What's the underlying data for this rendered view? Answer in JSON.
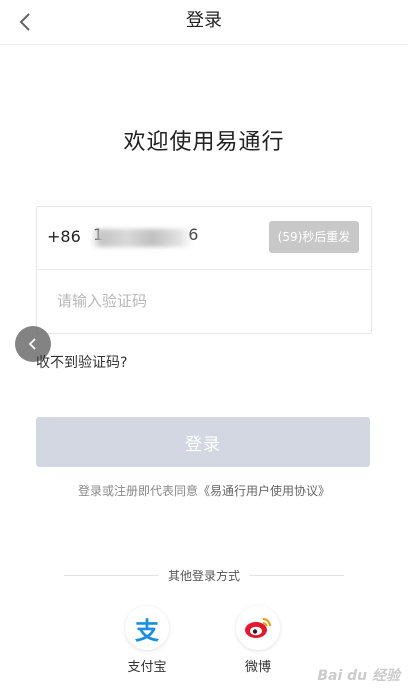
{
  "navbar": {
    "title": "登录"
  },
  "welcome": "欢迎使用易通行",
  "form": {
    "country_code": "+86",
    "phone_value": "1",
    "phone_tail": "6",
    "resend_label": "(59)秒后重发",
    "code_placeholder": "请输入验证码"
  },
  "no_code_link": "收不到验证码?",
  "login_button": "登录",
  "agreement": {
    "prefix": "登录或注册即代表同意",
    "link": "《易通行用户使用协议》"
  },
  "other_login": {
    "title": "其他登录方式",
    "methods": [
      {
        "label": "支付宝",
        "icon": "alipay-icon",
        "glyph": "支",
        "color": "#1a8fe1"
      },
      {
        "label": "微博",
        "icon": "weibo-icon",
        "color": "#e6162d"
      }
    ]
  },
  "colors": {
    "login_button_disabled": "#d3d7e1",
    "resend_disabled": "#c8c8c8"
  },
  "watermark": "Bai du 经验"
}
